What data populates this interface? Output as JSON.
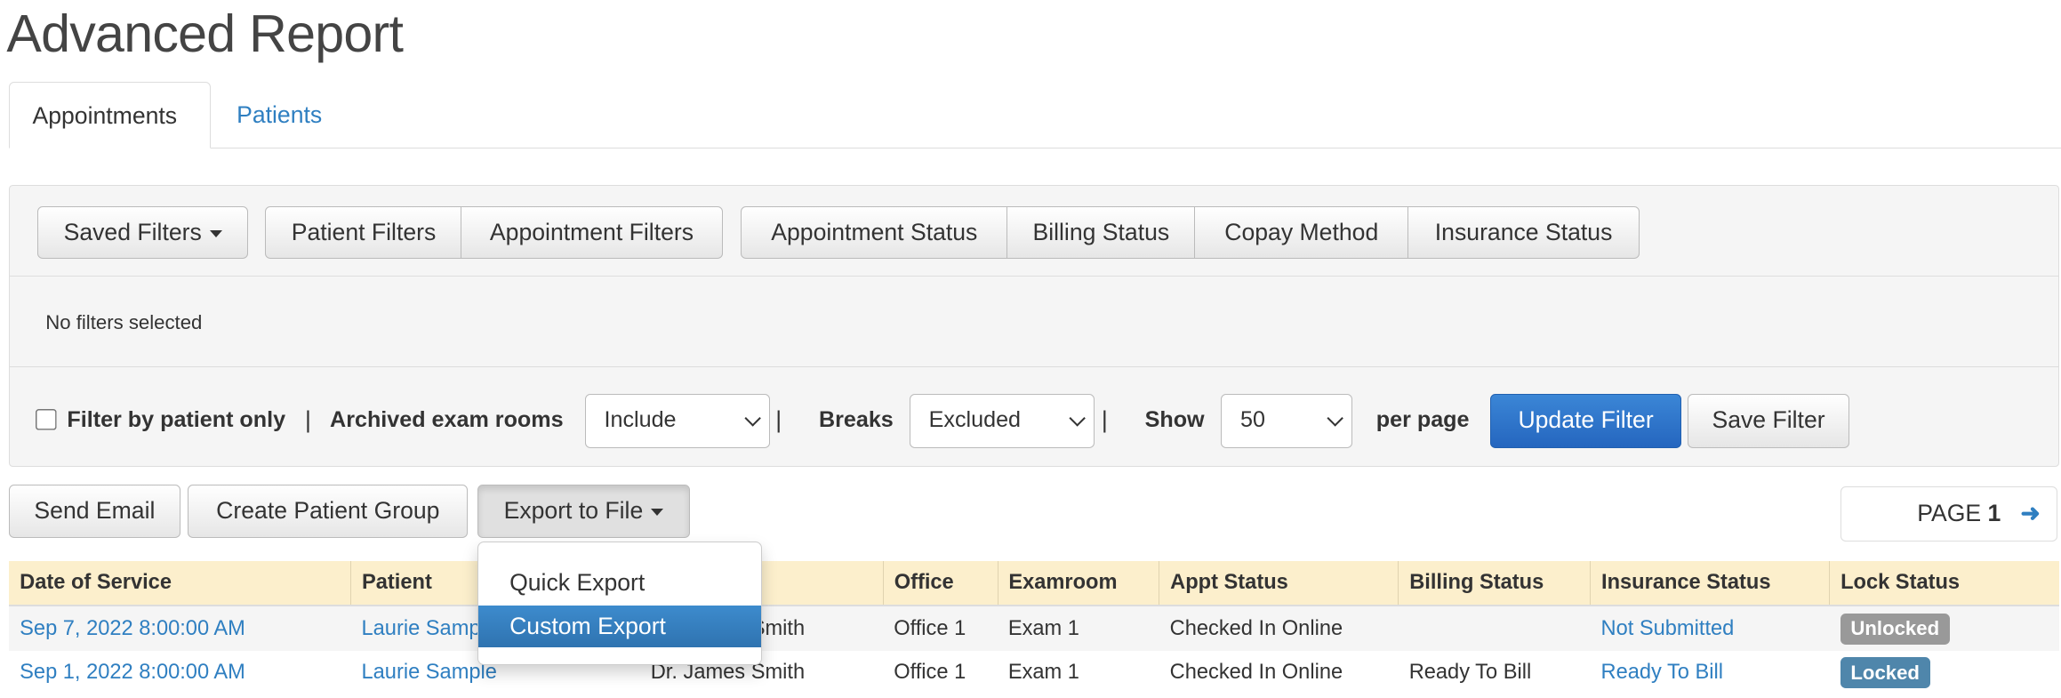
{
  "title": "Advanced Report",
  "tabs": [
    {
      "label": "Appointments",
      "active": true
    },
    {
      "label": "Patients",
      "active": false
    }
  ],
  "filters": {
    "saved_filters": "Saved Filters",
    "group1": [
      "Patient Filters",
      "Appointment Filters"
    ],
    "group2": [
      "Appointment Status",
      "Billing Status",
      "Copay Method",
      "Insurance Status"
    ],
    "status_text": "No filters selected",
    "filter_by_patient_label": "Filter by patient only",
    "filter_by_patient_checked": false,
    "archived_label": "Archived exam rooms",
    "archived_value": "Include",
    "breaks_label": "Breaks",
    "breaks_value": "Excluded",
    "show_label": "Show",
    "show_value": "50",
    "per_page_label": "per page",
    "update_button": "Update Filter",
    "save_button": "Save Filter",
    "separator": "|"
  },
  "actions": {
    "send_email": "Send Email",
    "create_group": "Create Patient Group",
    "export": "Export to File"
  },
  "export_menu": {
    "items": [
      "Quick Export",
      "Custom Export"
    ],
    "highlighted": "Custom Export"
  },
  "pagination": {
    "label": "PAGE",
    "page": "1"
  },
  "table": {
    "headers": [
      "Date of Service",
      "Patient",
      "",
      "Office",
      "Examroom",
      "Appt Status",
      "Billing Status",
      "Insurance Status",
      "Lock Status"
    ],
    "rows": [
      [
        "Sep 7, 2022 8:00:00 AM",
        "Laurie Sample",
        "Dr. James Smith",
        "Office 1",
        "Exam 1",
        "Checked In Online",
        "",
        "Not Submitted",
        "Unlocked"
      ],
      [
        "Sep 1, 2022 8:00:00 AM",
        "Laurie Sample",
        "Dr. James Smith",
        "Office 1",
        "Exam 1",
        "Checked In Online",
        "Ready To Bill",
        "Ready To Bill",
        "Locked"
      ]
    ]
  },
  "colors": {
    "link": "#2f7fc1",
    "primary": "#2e6fc9",
    "header_bg": "#fcefcc",
    "unlocked": "#999999",
    "locked": "#4f86ab"
  }
}
